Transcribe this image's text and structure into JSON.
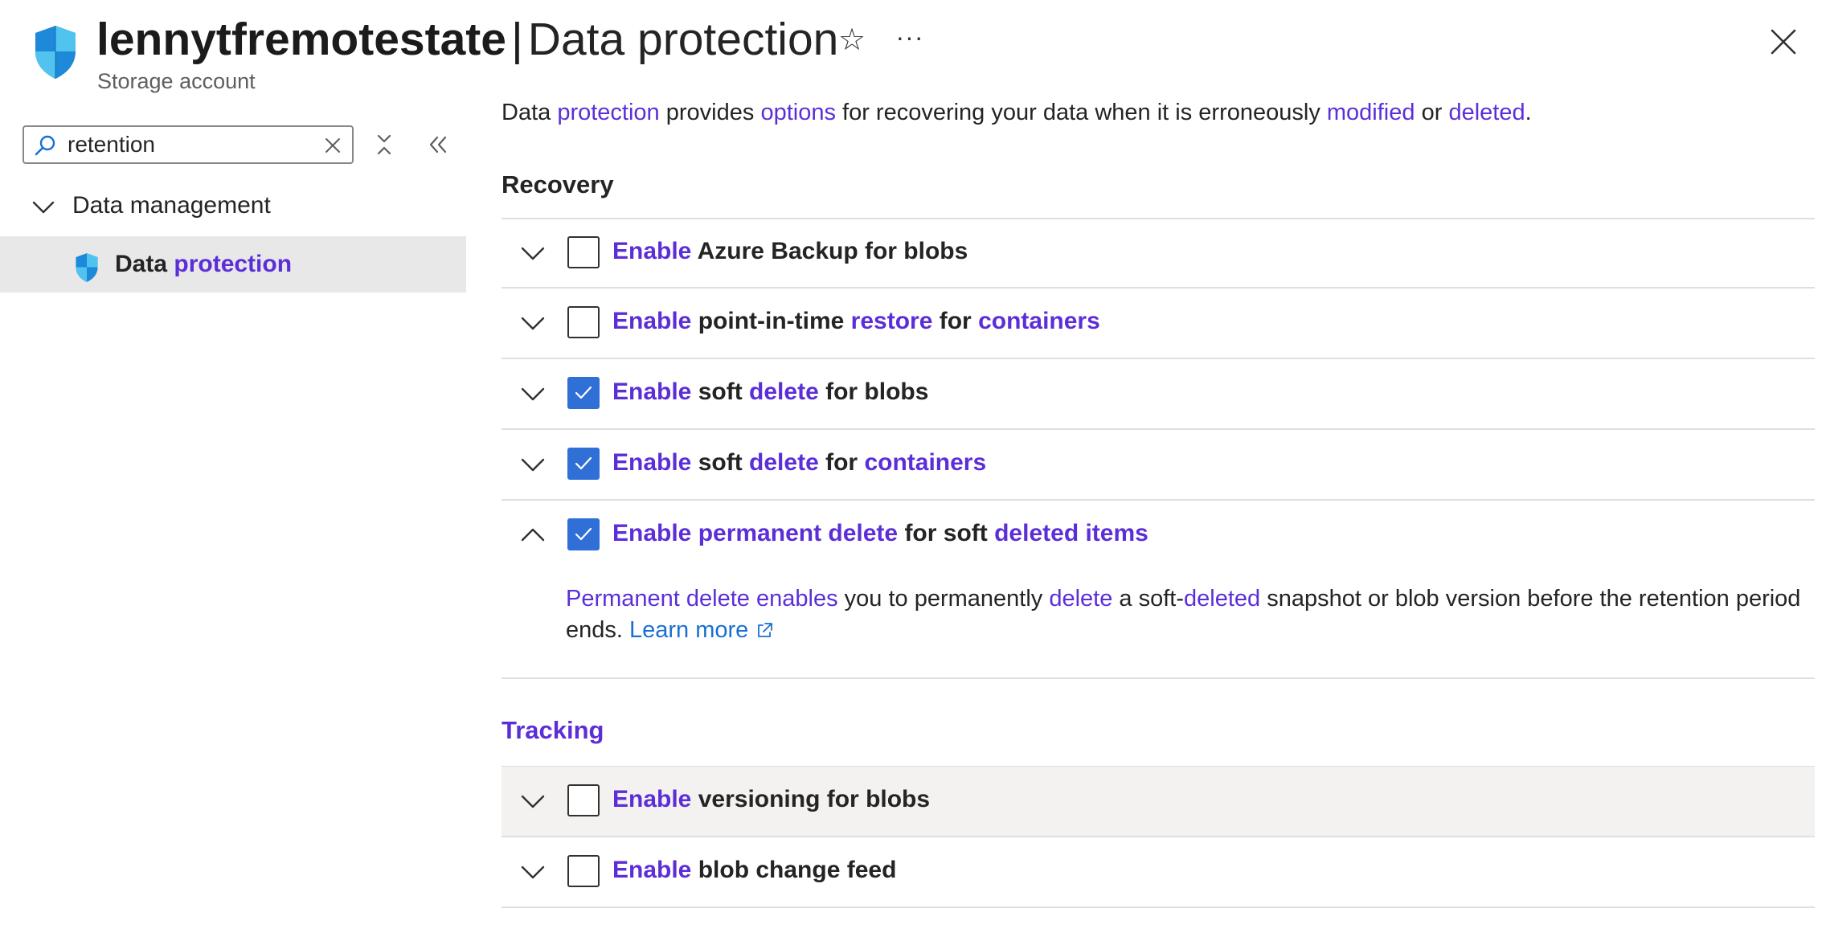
{
  "header": {
    "resource_name": "lennytfremotestate",
    "separator": "|",
    "page_title": "Data protection",
    "subtitle": "Storage account",
    "star_glyph": "☆",
    "more_glyph": "···"
  },
  "nav": {
    "search_value": "retention",
    "group_label": "Data management",
    "item_label_word1": "Data",
    "item_label_word2": "protection"
  },
  "main": {
    "intro": {
      "w1": "Data",
      "w2": "protection",
      "w3": "provides",
      "w4": "options",
      "w5": "for recovering your data when it is erroneously",
      "w6": "modified",
      "w7": "or",
      "w8": "deleted",
      "w9": "."
    },
    "recovery_heading": "Recovery",
    "tracking_heading": "Tracking",
    "rows": [
      {
        "checked": false,
        "expanded": false,
        "segments": [
          [
            "Enable",
            true
          ],
          [
            " Azure Backup for blobs",
            false
          ]
        ]
      },
      {
        "checked": false,
        "expanded": false,
        "segments": [
          [
            "Enable",
            true
          ],
          [
            " point-in-time ",
            false
          ],
          [
            "restore",
            true
          ],
          [
            " for ",
            false
          ],
          [
            "containers",
            true
          ]
        ]
      },
      {
        "checked": true,
        "expanded": false,
        "segments": [
          [
            "Enable",
            true
          ],
          [
            " soft ",
            false
          ],
          [
            "delete",
            true
          ],
          [
            " for blobs",
            false
          ]
        ]
      },
      {
        "checked": true,
        "expanded": false,
        "segments": [
          [
            "Enable",
            true
          ],
          [
            " soft ",
            false
          ],
          [
            "delete",
            true
          ],
          [
            " for ",
            false
          ],
          [
            "containers",
            true
          ]
        ]
      },
      {
        "checked": true,
        "expanded": true,
        "segments": [
          [
            "Enable permanent delete",
            true
          ],
          [
            " for soft ",
            false
          ],
          [
            "deleted items",
            true
          ]
        ]
      },
      {
        "checked": false,
        "expanded": false,
        "segments": [
          [
            "Enable",
            true
          ],
          [
            " versioning for blobs",
            false
          ]
        ]
      },
      {
        "checked": false,
        "expanded": false,
        "segments": [
          [
            "Enable",
            true
          ],
          [
            " blob change feed",
            false
          ]
        ]
      }
    ],
    "perm_desc": {
      "p1": "Permanent delete enables",
      "p2": " you to permanently ",
      "p3": "delete",
      "p4": " a soft-",
      "p5": "deleted",
      "p6": " snapshot or blob version before the retention period ends.",
      "learn_more": "Learn more"
    }
  },
  "colors": {
    "accent": "#5c2ed8",
    "link": "#1a6fd1",
    "checkbox_checked": "#2f6fd6",
    "nav_selected_bg": "#e8e8e8",
    "row_hover_bg": "#f3f2f1"
  },
  "icons": [
    "shield-icon",
    "star-icon",
    "more-icon",
    "close-icon",
    "search-icon",
    "clear-icon",
    "collapse-all-icon",
    "double-chevron-left-icon",
    "chevron-down-icon",
    "chevron-up-icon",
    "checkmark-icon",
    "external-link-icon"
  ]
}
